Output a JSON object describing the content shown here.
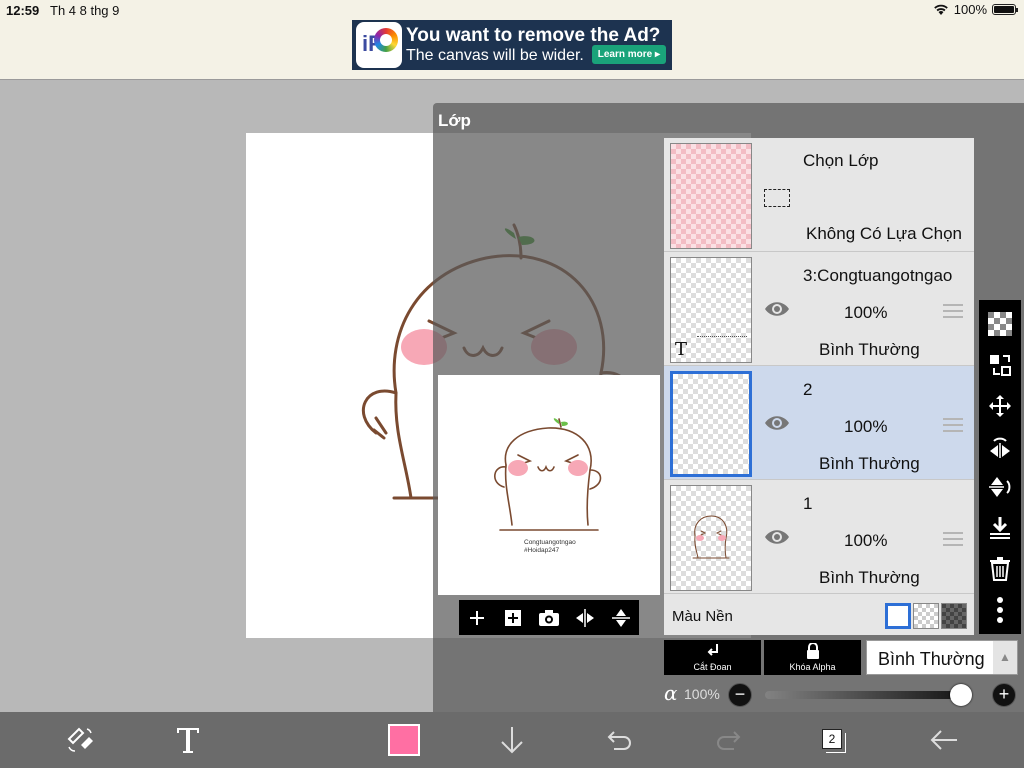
{
  "status": {
    "time": "12:59",
    "date": "Th 4 8 thg 9",
    "battery": "100%"
  },
  "ad": {
    "title": "You want to remove the Ad?",
    "subtitle": "The canvas will be wider.",
    "button": "Learn more ▸",
    "logo_text": "iP"
  },
  "panel": {
    "title": "Lớp",
    "selection_layer": {
      "name": "Chọn Lớp",
      "status": "Không Có Lựa Chọn"
    },
    "layers": [
      {
        "name": "3:Congtuangotngao",
        "opacity": "100%",
        "mode": "Bình Thường",
        "selected": false
      },
      {
        "name": "2",
        "opacity": "100%",
        "mode": "Bình Thường",
        "selected": true
      },
      {
        "name": "1",
        "opacity": "100%",
        "mode": "Bình Thường",
        "selected": false
      }
    ],
    "background_label": "Màu Nền",
    "clip_label": "Cắt Đoan",
    "alpha_lock_label": "Khóa Alpha",
    "blend_mode": "Bình Thường",
    "alpha_symbol": "α",
    "alpha_value": "100%",
    "alpha_fraction": 1.0,
    "minus": "−",
    "plus": "+",
    "thumb_type_icon": "T"
  },
  "artwork": {
    "caption1": "Congtuangotngao",
    "caption2": "#Hoidap247"
  },
  "bottom": {
    "layer_count": "2",
    "color": "#ff6fa3"
  },
  "icons": [
    "plus-icon",
    "add-layer-icon",
    "camera-icon",
    "flip-horizontal-icon",
    "flip-vertical-icon",
    "eye-icon",
    "drag-handle-icon",
    "checker-icon",
    "transform-icon",
    "move-icon",
    "flip-h-icon",
    "flip-v-icon",
    "merge-down-icon",
    "trash-icon",
    "more-icon"
  ]
}
